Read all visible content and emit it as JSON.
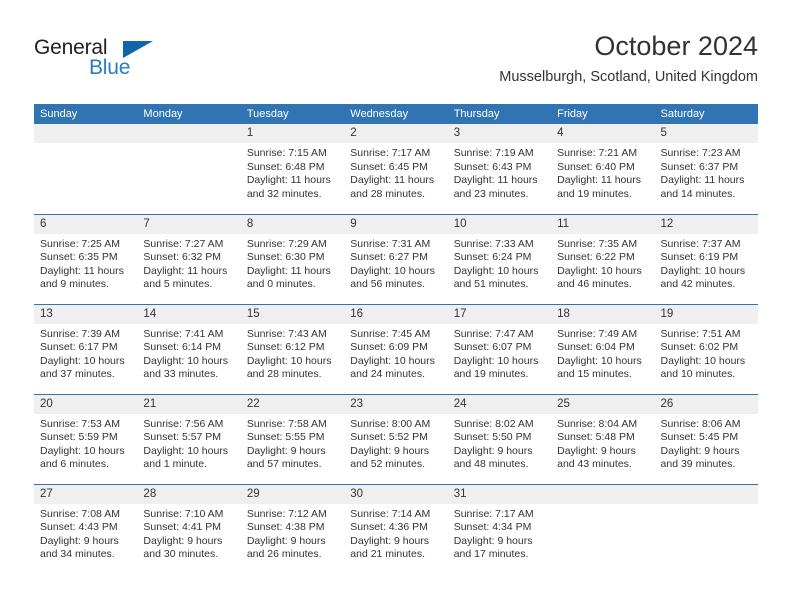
{
  "brand": {
    "name_top": "General",
    "name_bottom": "Blue",
    "triangle_color": "#1166aa",
    "blue_color": "#2b7cc4"
  },
  "header": {
    "title": "October 2024",
    "subtitle": "Musselburgh, Scotland, United Kingdom"
  },
  "theme": {
    "header_blue": "#3074b3",
    "daynum_band": "#efefef",
    "text": "#333333"
  },
  "calendar": {
    "weekday_headers": [
      "Sunday",
      "Monday",
      "Tuesday",
      "Wednesday",
      "Thursday",
      "Friday",
      "Saturday"
    ],
    "weeks": [
      [
        {
          "day": "",
          "lines": []
        },
        {
          "day": "",
          "lines": []
        },
        {
          "day": "1",
          "lines": [
            "Sunrise: 7:15 AM",
            "Sunset: 6:48 PM",
            "Daylight: 11 hours",
            "and 32 minutes."
          ]
        },
        {
          "day": "2",
          "lines": [
            "Sunrise: 7:17 AM",
            "Sunset: 6:45 PM",
            "Daylight: 11 hours",
            "and 28 minutes."
          ]
        },
        {
          "day": "3",
          "lines": [
            "Sunrise: 7:19 AM",
            "Sunset: 6:43 PM",
            "Daylight: 11 hours",
            "and 23 minutes."
          ]
        },
        {
          "day": "4",
          "lines": [
            "Sunrise: 7:21 AM",
            "Sunset: 6:40 PM",
            "Daylight: 11 hours",
            "and 19 minutes."
          ]
        },
        {
          "day": "5",
          "lines": [
            "Sunrise: 7:23 AM",
            "Sunset: 6:37 PM",
            "Daylight: 11 hours",
            "and 14 minutes."
          ]
        }
      ],
      [
        {
          "day": "6",
          "lines": [
            "Sunrise: 7:25 AM",
            "Sunset: 6:35 PM",
            "Daylight: 11 hours",
            "and 9 minutes."
          ]
        },
        {
          "day": "7",
          "lines": [
            "Sunrise: 7:27 AM",
            "Sunset: 6:32 PM",
            "Daylight: 11 hours",
            "and 5 minutes."
          ]
        },
        {
          "day": "8",
          "lines": [
            "Sunrise: 7:29 AM",
            "Sunset: 6:30 PM",
            "Daylight: 11 hours",
            "and 0 minutes."
          ]
        },
        {
          "day": "9",
          "lines": [
            "Sunrise: 7:31 AM",
            "Sunset: 6:27 PM",
            "Daylight: 10 hours",
            "and 56 minutes."
          ]
        },
        {
          "day": "10",
          "lines": [
            "Sunrise: 7:33 AM",
            "Sunset: 6:24 PM",
            "Daylight: 10 hours",
            "and 51 minutes."
          ]
        },
        {
          "day": "11",
          "lines": [
            "Sunrise: 7:35 AM",
            "Sunset: 6:22 PM",
            "Daylight: 10 hours",
            "and 46 minutes."
          ]
        },
        {
          "day": "12",
          "lines": [
            "Sunrise: 7:37 AM",
            "Sunset: 6:19 PM",
            "Daylight: 10 hours",
            "and 42 minutes."
          ]
        }
      ],
      [
        {
          "day": "13",
          "lines": [
            "Sunrise: 7:39 AM",
            "Sunset: 6:17 PM",
            "Daylight: 10 hours",
            "and 37 minutes."
          ]
        },
        {
          "day": "14",
          "lines": [
            "Sunrise: 7:41 AM",
            "Sunset: 6:14 PM",
            "Daylight: 10 hours",
            "and 33 minutes."
          ]
        },
        {
          "day": "15",
          "lines": [
            "Sunrise: 7:43 AM",
            "Sunset: 6:12 PM",
            "Daylight: 10 hours",
            "and 28 minutes."
          ]
        },
        {
          "day": "16",
          "lines": [
            "Sunrise: 7:45 AM",
            "Sunset: 6:09 PM",
            "Daylight: 10 hours",
            "and 24 minutes."
          ]
        },
        {
          "day": "17",
          "lines": [
            "Sunrise: 7:47 AM",
            "Sunset: 6:07 PM",
            "Daylight: 10 hours",
            "and 19 minutes."
          ]
        },
        {
          "day": "18",
          "lines": [
            "Sunrise: 7:49 AM",
            "Sunset: 6:04 PM",
            "Daylight: 10 hours",
            "and 15 minutes."
          ]
        },
        {
          "day": "19",
          "lines": [
            "Sunrise: 7:51 AM",
            "Sunset: 6:02 PM",
            "Daylight: 10 hours",
            "and 10 minutes."
          ]
        }
      ],
      [
        {
          "day": "20",
          "lines": [
            "Sunrise: 7:53 AM",
            "Sunset: 5:59 PM",
            "Daylight: 10 hours",
            "and 6 minutes."
          ]
        },
        {
          "day": "21",
          "lines": [
            "Sunrise: 7:56 AM",
            "Sunset: 5:57 PM",
            "Daylight: 10 hours",
            "and 1 minute."
          ]
        },
        {
          "day": "22",
          "lines": [
            "Sunrise: 7:58 AM",
            "Sunset: 5:55 PM",
            "Daylight: 9 hours",
            "and 57 minutes."
          ]
        },
        {
          "day": "23",
          "lines": [
            "Sunrise: 8:00 AM",
            "Sunset: 5:52 PM",
            "Daylight: 9 hours",
            "and 52 minutes."
          ]
        },
        {
          "day": "24",
          "lines": [
            "Sunrise: 8:02 AM",
            "Sunset: 5:50 PM",
            "Daylight: 9 hours",
            "and 48 minutes."
          ]
        },
        {
          "day": "25",
          "lines": [
            "Sunrise: 8:04 AM",
            "Sunset: 5:48 PM",
            "Daylight: 9 hours",
            "and 43 minutes."
          ]
        },
        {
          "day": "26",
          "lines": [
            "Sunrise: 8:06 AM",
            "Sunset: 5:45 PM",
            "Daylight: 9 hours",
            "and 39 minutes."
          ]
        }
      ],
      [
        {
          "day": "27",
          "lines": [
            "Sunrise: 7:08 AM",
            "Sunset: 4:43 PM",
            "Daylight: 9 hours",
            "and 34 minutes."
          ]
        },
        {
          "day": "28",
          "lines": [
            "Sunrise: 7:10 AM",
            "Sunset: 4:41 PM",
            "Daylight: 9 hours",
            "and 30 minutes."
          ]
        },
        {
          "day": "29",
          "lines": [
            "Sunrise: 7:12 AM",
            "Sunset: 4:38 PM",
            "Daylight: 9 hours",
            "and 26 minutes."
          ]
        },
        {
          "day": "30",
          "lines": [
            "Sunrise: 7:14 AM",
            "Sunset: 4:36 PM",
            "Daylight: 9 hours",
            "and 21 minutes."
          ]
        },
        {
          "day": "31",
          "lines": [
            "Sunrise: 7:17 AM",
            "Sunset: 4:34 PM",
            "Daylight: 9 hours",
            "and 17 minutes."
          ]
        },
        {
          "day": "",
          "lines": []
        },
        {
          "day": "",
          "lines": []
        }
      ]
    ]
  }
}
